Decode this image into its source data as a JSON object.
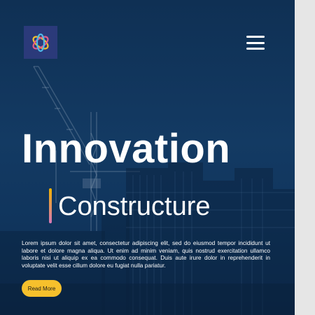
{
  "hero": {
    "title": "Innovation",
    "subtitle": "Constructure",
    "body": "Lorem ipsum dolor sit amet, consectetur adipiscing elit, sed do eiusmod tempor incididunt ut labore et dolore magna aliqua. Ut enim ad minim veniam, quis nostrud exercitation ullamco laboris nisi ut aliquip ex ea commodo consequat. Duis aute irure dolor in reprehenderit in voluptate velit esse cillum dolore eu fugiat nulla pariatur.",
    "read_more_label": "Read More"
  },
  "icons": {
    "logo": "atom-logo-icon",
    "menu": "hamburger-menu-icon"
  },
  "colors": {
    "hero_overlay": "#133a63",
    "accent_yellow": "#f6c02c",
    "accent_pink": "#d678b8",
    "logo_bg": "#2b3a7a",
    "text": "#ffffff"
  }
}
